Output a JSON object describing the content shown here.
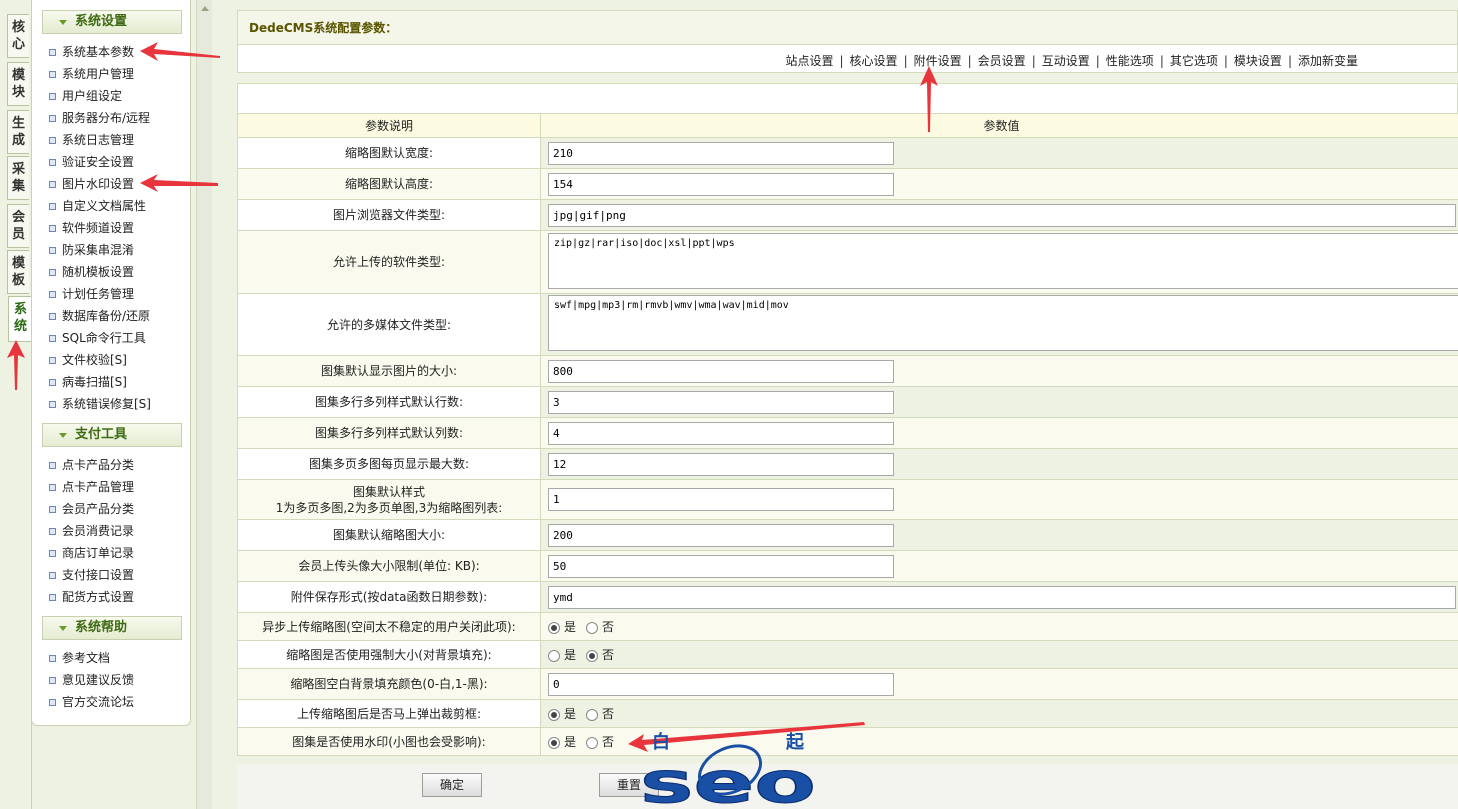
{
  "vertical_tabs": [
    {
      "label": "核心",
      "active": false
    },
    {
      "label": "模块",
      "active": false
    },
    {
      "label": "生成",
      "active": false
    },
    {
      "label": "采集",
      "active": false
    },
    {
      "label": "会员",
      "active": false
    },
    {
      "label": "模板",
      "active": false
    },
    {
      "label": "系统",
      "active": true
    }
  ],
  "sidebar": {
    "sections": [
      {
        "title": "系统设置",
        "items": [
          "系统基本参数",
          "系统用户管理",
          "用户组设定",
          "服务器分布/远程",
          "系统日志管理",
          "验证安全设置",
          "图片水印设置",
          "自定义文档属性",
          "软件频道设置",
          "防采集串混淆",
          "随机模板设置",
          "计划任务管理",
          "数据库备份/还原",
          "SQL命令行工具",
          "文件校验[S]",
          "病毒扫描[S]",
          "系统错误修复[S]"
        ]
      },
      {
        "title": "支付工具",
        "items": [
          "点卡产品分类",
          "点卡产品管理",
          "会员产品分类",
          "会员消费记录",
          "商店订单记录",
          "支付接口设置",
          "配货方式设置"
        ]
      },
      {
        "title": "系统帮助",
        "items": [
          "参考文档",
          "意见建议反馈",
          "官方交流论坛"
        ]
      }
    ]
  },
  "main": {
    "title": "DedeCMS系统配置参数：",
    "nav": [
      "站点设置",
      "核心设置",
      "附件设置",
      "会员设置",
      "互动设置",
      "性能选项",
      "其它选项",
      "模块设置",
      "添加新变量"
    ],
    "table": {
      "headers": [
        "参数说明",
        "参数值"
      ],
      "rows": [
        {
          "label": "缩略图默认宽度:",
          "type": "input",
          "value": "210"
        },
        {
          "label": "缩略图默认高度:",
          "type": "input",
          "value": "154"
        },
        {
          "label": "图片浏览器文件类型:",
          "type": "input-wide",
          "value": "jpg|gif|png"
        },
        {
          "label": "允许上传的软件类型:",
          "type": "textarea",
          "value": "zip|gz|rar|iso|doc|xsl|ppt|wps"
        },
        {
          "label": "允许的多媒体文件类型:",
          "type": "textarea",
          "value": "swf|mpg|mp3|rm|rmvb|wmv|wma|wav|mid|mov"
        },
        {
          "label": "图集默认显示图片的大小:",
          "type": "input",
          "value": "800"
        },
        {
          "label": "图集多行多列样式默认行数:",
          "type": "input",
          "value": "3"
        },
        {
          "label": "图集多行多列样式默认列数:",
          "type": "input",
          "value": "4"
        },
        {
          "label": "图集多页多图每页显示最大数:",
          "type": "input",
          "value": "12"
        },
        {
          "label": "图集默认样式",
          "label2": "1为多页多图,2为多页单图,3为缩略图列表:",
          "type": "input",
          "value": "1"
        },
        {
          "label": "图集默认缩略图大小:",
          "type": "input",
          "value": "200"
        },
        {
          "label": "会员上传头像大小限制(单位: KB):",
          "type": "input",
          "value": "50"
        },
        {
          "label": "附件保存形式(按data函数日期参数):",
          "type": "input-wide",
          "value": "ymd"
        },
        {
          "label": "异步上传缩略图(空间太不稳定的用户关闭此项):",
          "type": "radio",
          "selected": "yes"
        },
        {
          "label": "缩略图是否使用强制大小(对背景填充):",
          "type": "radio",
          "selected": "no"
        },
        {
          "label": "缩略图空白背景填充颜色(0-白,1-黑):",
          "type": "input",
          "value": "0"
        },
        {
          "label": "上传缩略图后是否马上弹出裁剪框:",
          "type": "radio",
          "selected": "yes"
        },
        {
          "label": "图集是否使用水印(小图也会受影响):",
          "type": "radio",
          "selected": "yes"
        }
      ],
      "radio_yes": "是",
      "radio_no": "否"
    },
    "buttons": {
      "confirm": "确定",
      "reset": "重置"
    }
  },
  "watermark": {
    "top_left": "白",
    "top_right": "起",
    "letters": "seo"
  },
  "colors": {
    "arrow": "#e8343c",
    "accent_green": "#3f6b14",
    "header_bg": "#fcfbe2"
  }
}
